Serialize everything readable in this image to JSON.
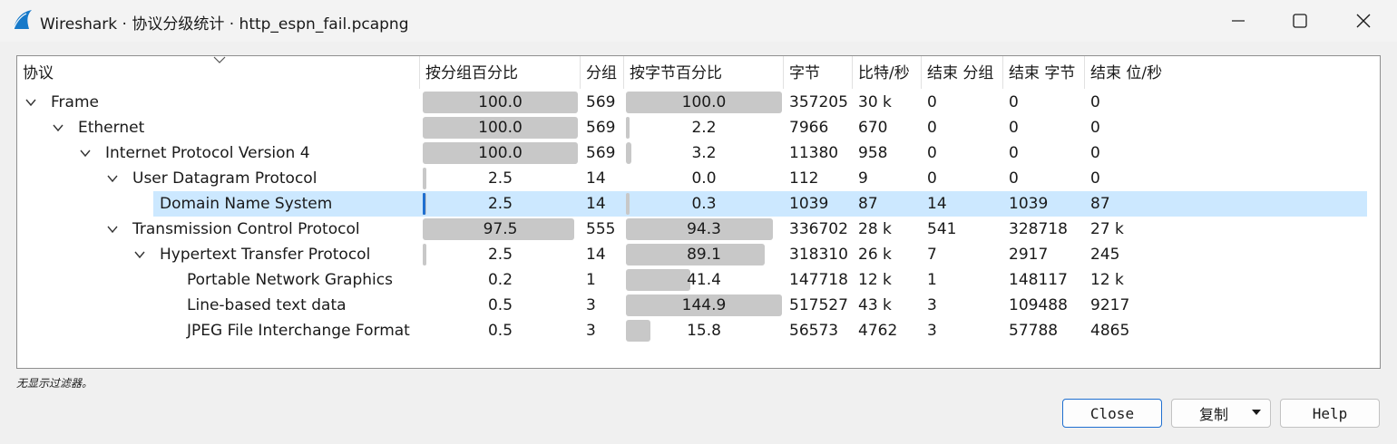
{
  "window": {
    "title": "Wireshark · 协议分级统计 · http_espn_fail.pcapng"
  },
  "columns": [
    "协议",
    "按分组百分比",
    "分组",
    "按字节百分比",
    "字节",
    "比特/秒",
    "结束 分组",
    "结束 字节",
    "结束 位/秒"
  ],
  "rows": [
    {
      "protocol": "Frame",
      "pkt_pct": "100.0",
      "pkt_pct_fill": 1.0,
      "packets": "569",
      "byte_pct": "100.0",
      "byte_pct_fill": 1.0,
      "bytes": "357205",
      "bps": "30 k",
      "end_packets": "0",
      "end_bytes": "0",
      "end_bps": "0"
    },
    {
      "protocol": "Ethernet",
      "pkt_pct": "100.0",
      "pkt_pct_fill": 1.0,
      "packets": "569",
      "byte_pct": "2.2",
      "byte_pct_fill": 0.022,
      "bytes": "7966",
      "bps": "670",
      "end_packets": "0",
      "end_bytes": "0",
      "end_bps": "0"
    },
    {
      "protocol": "Internet Protocol Version 4",
      "pkt_pct": "100.0",
      "pkt_pct_fill": 1.0,
      "packets": "569",
      "byte_pct": "3.2",
      "byte_pct_fill": 0.032,
      "bytes": "11380",
      "bps": "958",
      "end_packets": "0",
      "end_bytes": "0",
      "end_bps": "0"
    },
    {
      "protocol": "User Datagram Protocol",
      "pkt_pct": "2.5",
      "pkt_pct_fill": 0.025,
      "packets": "14",
      "byte_pct": "0.0",
      "byte_pct_fill": 0.0,
      "bytes": "112",
      "bps": "9",
      "end_packets": "0",
      "end_bytes": "0",
      "end_bps": "0"
    },
    {
      "protocol": "Domain Name System",
      "pkt_pct": "2.5",
      "pkt_pct_fill": 0.025,
      "packets": "14",
      "byte_pct": "0.3",
      "byte_pct_fill": 0.003,
      "bytes": "1039",
      "bps": "87",
      "end_packets": "14",
      "end_bytes": "1039",
      "end_bps": "87"
    },
    {
      "protocol": "Transmission Control Protocol",
      "pkt_pct": "97.5",
      "pkt_pct_fill": 0.975,
      "packets": "555",
      "byte_pct": "94.3",
      "byte_pct_fill": 0.943,
      "bytes": "336702",
      "bps": "28 k",
      "end_packets": "541",
      "end_bytes": "328718",
      "end_bps": "27 k"
    },
    {
      "protocol": "Hypertext Transfer Protocol",
      "pkt_pct": "2.5",
      "pkt_pct_fill": 0.025,
      "packets": "14",
      "byte_pct": "89.1",
      "byte_pct_fill": 0.891,
      "bytes": "318310",
      "bps": "26 k",
      "end_packets": "7",
      "end_bytes": "2917",
      "end_bps": "245"
    },
    {
      "protocol": "Portable Network Graphics",
      "pkt_pct": "0.2",
      "pkt_pct_fill": 0.0,
      "packets": "1",
      "byte_pct": "41.4",
      "byte_pct_fill": 0.414,
      "bytes": "147718",
      "bps": "12 k",
      "end_packets": "1",
      "end_bytes": "148117",
      "end_bps": "12 k"
    },
    {
      "protocol": "Line-based text data",
      "pkt_pct": "0.5",
      "pkt_pct_fill": 0.0,
      "packets": "3",
      "byte_pct": "144.9",
      "byte_pct_fill": 1.0,
      "bytes": "517527",
      "bps": "43 k",
      "end_packets": "3",
      "end_bytes": "109488",
      "end_bps": "9217"
    },
    {
      "protocol": "JPEG File Interchange Format",
      "pkt_pct": "0.5",
      "pkt_pct_fill": 0.0,
      "packets": "3",
      "byte_pct": "15.8",
      "byte_pct_fill": 0.158,
      "bytes": "56573",
      "bps": "4762",
      "end_packets": "3",
      "end_bytes": "57788",
      "end_bps": "4865"
    }
  ],
  "status": "无显示过滤器。",
  "buttons": {
    "close": "Close",
    "copy": "复制",
    "help": "Help"
  },
  "colors": {
    "selection": "#cce8ff",
    "bar": "#c8c8c8",
    "accent": "#1f6fd0"
  }
}
